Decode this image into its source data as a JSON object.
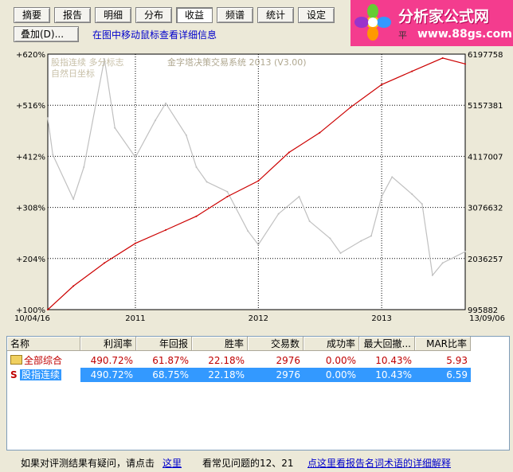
{
  "tabs": [
    {
      "label": "摘要",
      "active": false
    },
    {
      "label": "报告",
      "active": false
    },
    {
      "label": "明细",
      "active": false
    },
    {
      "label": "分布",
      "active": false
    },
    {
      "label": "收益",
      "active": true
    },
    {
      "label": "频谱",
      "active": false
    },
    {
      "label": "统计",
      "active": false
    },
    {
      "label": "设定",
      "active": false
    }
  ],
  "overlay_button": "叠加(D)...",
  "hint": "在图中移动鼠标查看详细信息",
  "logo": {
    "title": "分析家公式网",
    "url": "www.88gs.com",
    "partial_text": "平"
  },
  "chart_data": {
    "type": "line",
    "title": "金字塔决策交易系统 2013 (V3.00)",
    "overlay_labels": [
      "股指连续 多分标志",
      "自然日坐标"
    ],
    "left_ticks": [
      "+620%",
      "+516%",
      "+412%",
      "+308%",
      "+204%",
      "+100%"
    ],
    "right_ticks": [
      "6197758",
      "5157381",
      "4117007",
      "3076632",
      "2036257",
      "995882"
    ],
    "x_ticks": [
      "10/04/16",
      "2011",
      "2012",
      "2013",
      "13/09/06"
    ],
    "series": [
      {
        "color": "#cc0000",
        "x": [
          "10/04/16",
          "2010-07",
          "2010-10",
          "2011-01",
          "2011-04",
          "2011-07",
          "2011-10",
          "2012-01",
          "2012-04",
          "2012-07",
          "2012-10",
          "2013-01",
          "2013-04",
          "2013-07",
          "13/09/06"
        ],
        "y": [
          100,
          148,
          195,
          235,
          262,
          290,
          330,
          362,
          420,
          460,
          512,
          558,
          585,
          612,
          600
        ]
      },
      {
        "color": "#c0c0c0",
        "x": [
          "10/04/16",
          "2010-05",
          "2010-07",
          "2010-08",
          "2010-10",
          "2010-11",
          "2011-01",
          "2011-03",
          "2011-04",
          "2011-06",
          "2011-07",
          "2011-08",
          "2011-10",
          "2011-12",
          "2012-01",
          "2012-03",
          "2012-05",
          "2012-06",
          "2012-08",
          "2012-09",
          "2012-11",
          "2012-12",
          "2013-01",
          "2013-02",
          "2013-04",
          "2013-05",
          "2013-06",
          "2013-07",
          "13/09/06"
        ],
        "y": [
          490,
          415,
          325,
          390,
          610,
          470,
          410,
          485,
          520,
          455,
          390,
          360,
          340,
          260,
          232,
          295,
          330,
          280,
          245,
          215,
          240,
          250,
          330,
          370,
          335,
          315,
          170,
          195,
          218
        ]
      }
    ]
  },
  "table": {
    "columns": [
      "名称",
      "利润率",
      "年回报",
      "胜率",
      "交易数",
      "成功率",
      "最大回撤...",
      "MAR比率"
    ],
    "rows": [
      {
        "icon": "folder-icon",
        "name": "全部综合",
        "cells": [
          "490.72%",
          "61.87%",
          "22.18%",
          "2976",
          "0.00%",
          "10.43%",
          "5.93"
        ],
        "style": "red"
      },
      {
        "icon": "s-icon",
        "icon_text": "S",
        "name": "股指连续",
        "cells": [
          "490.72%",
          "68.75%",
          "22.18%",
          "2976",
          "0.00%",
          "10.43%",
          "6.59"
        ],
        "style": "selected"
      }
    ]
  },
  "footer": {
    "t1": "如果对评测结果有疑问，请点击",
    "link1": "这里",
    "t2": "看常见问题的12、21",
    "link2": "点这里看报告名词术语的详细解释"
  }
}
